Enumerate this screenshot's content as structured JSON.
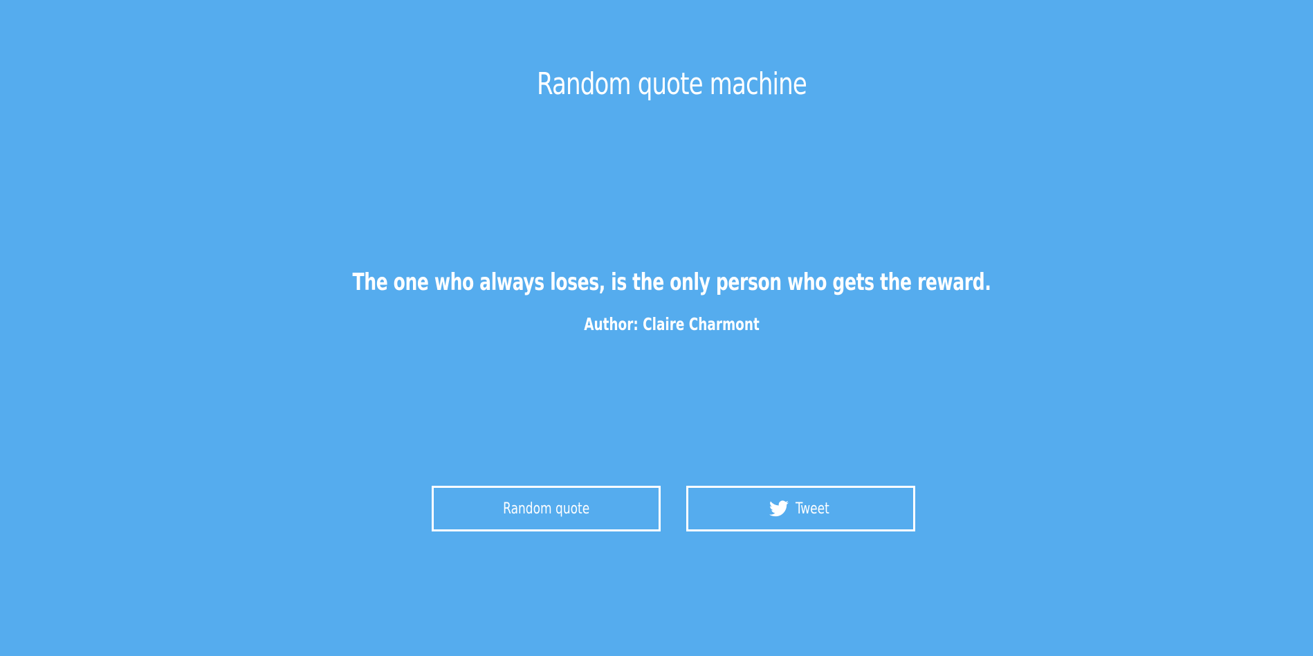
{
  "page": {
    "title": "Random quote machine",
    "background_color": "#55acee",
    "text_color": "#ffffff"
  },
  "quote": {
    "text": "The one who always loses, is the only person who gets the reward.",
    "author": "Author: Claire Charmont"
  },
  "buttons": {
    "random_label": "Random quote",
    "tweet_label": "Tweet",
    "tweet_icon": "twitter-bird-icon"
  }
}
